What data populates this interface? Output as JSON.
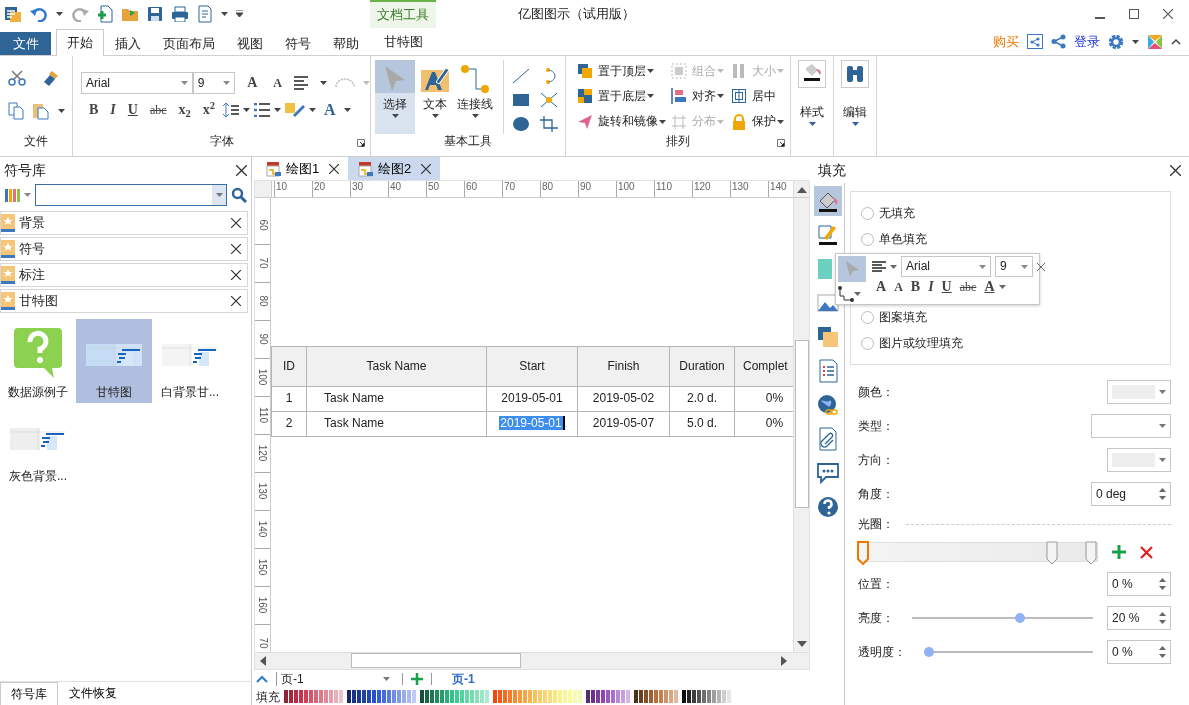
{
  "window": {
    "title": "亿图图示（试用版）",
    "tool_group": "文档工具"
  },
  "menu_tabs": [
    {
      "label": "文件",
      "kind": "file",
      "selected": false
    },
    {
      "label": "开始",
      "kind": "tab",
      "selected": true
    },
    {
      "label": "插入",
      "kind": "tab",
      "selected": false
    },
    {
      "label": "页面布局",
      "kind": "tab",
      "selected": false
    },
    {
      "label": "视图",
      "kind": "tab",
      "selected": false
    },
    {
      "label": "符号",
      "kind": "tab",
      "selected": false
    },
    {
      "label": "帮助",
      "kind": "tab",
      "selected": false
    },
    {
      "label": "甘特图",
      "kind": "context",
      "selected": false
    }
  ],
  "account": {
    "buy": "购买",
    "login": "登录"
  },
  "ribbon": {
    "file_group": {
      "label": "文件"
    },
    "font_group": {
      "label": "字体",
      "family": "Arial",
      "size": "9",
      "grow": "A",
      "shrink": "A",
      "color_glyph": "A",
      "styles": [
        {
          "text": "B",
          "kind": "bold"
        },
        {
          "text": "I",
          "kind": "italic"
        },
        {
          "text": "U",
          "kind": "underline"
        },
        {
          "text": "abc",
          "kind": "strike"
        },
        {
          "text": "x$_{2}$",
          "kind": "sub"
        },
        {
          "text": "x$^{2}$",
          "kind": "sup"
        }
      ]
    },
    "tools_group": {
      "label": "基本工具",
      "tools": [
        {
          "label": "选择",
          "kind": "select",
          "selected": true
        },
        {
          "label": "文本",
          "kind": "text",
          "selected": false
        },
        {
          "label": "连接线",
          "kind": "connector",
          "selected": false
        }
      ]
    },
    "arrange_group": {
      "label": "排列",
      "items": [
        {
          "label": "置于顶层",
          "kind": "front",
          "disabled": false,
          "dropdown": true
        },
        {
          "label": "组合",
          "kind": "group",
          "disabled": true,
          "dropdown": true
        },
        {
          "label": "大小",
          "kind": "size",
          "disabled": true,
          "dropdown": true
        },
        {
          "label": "置于底层",
          "kind": "back",
          "disabled": false,
          "dropdown": true
        },
        {
          "label": "对齐",
          "kind": "align",
          "disabled": false,
          "dropdown": true
        },
        {
          "label": "居中",
          "kind": "center",
          "disabled": false,
          "dropdown": false
        },
        {
          "label": "旋转和镜像",
          "kind": "rotate",
          "disabled": false,
          "dropdown": true
        },
        {
          "label": "分布",
          "kind": "distribute",
          "disabled": true,
          "dropdown": true
        },
        {
          "label": "保护",
          "kind": "protect",
          "disabled": false,
          "dropdown": true
        }
      ]
    },
    "style_group": {
      "label": "样式"
    },
    "edit_group": {
      "label": "编辑"
    }
  },
  "symbol_library": {
    "title": "符号库",
    "libraries": [
      {
        "label": "背景"
      },
      {
        "label": "符号"
      },
      {
        "label": "标注"
      },
      {
        "label": "甘特图"
      }
    ],
    "templates": [
      {
        "label": "数据源例子",
        "kind": "question",
        "selected": false
      },
      {
        "label": "甘特图",
        "kind": "gantt",
        "selected": true
      },
      {
        "label": "白背景甘...",
        "kind": "gantt-white",
        "selected": false
      },
      {
        "label": "灰色背景...",
        "kind": "gantt-gray",
        "selected": false
      }
    ],
    "bottom_tabs": [
      {
        "label": "符号库",
        "selected": true
      },
      {
        "label": "文件恢复",
        "selected": false
      }
    ]
  },
  "documents": [
    {
      "label": "绘图1",
      "selected": false
    },
    {
      "label": "绘图2",
      "selected": true
    }
  ],
  "rulers": {
    "horizontal": [
      "10",
      "20",
      "30",
      "40",
      "50",
      "60",
      "70",
      "80",
      "90",
      "100",
      "110",
      "120",
      "130",
      "140"
    ],
    "vertical": [
      "60",
      "70",
      "80",
      "90",
      "100",
      "110",
      "120",
      "130",
      "140",
      "150",
      "160",
      "70"
    ]
  },
  "table": {
    "columns": [
      "ID",
      "Task Name",
      "Start",
      "Finish",
      "Duration",
      "Complet"
    ],
    "rows": [
      {
        "cells": [
          {
            "text": "1",
            "selected": false
          },
          {
            "text": "Task Name",
            "selected": false
          },
          {
            "text": "2019-05-01",
            "selected": false
          },
          {
            "text": "2019-05-02",
            "selected": false
          },
          {
            "text": "2.0 d.",
            "selected": false
          },
          {
            "text": "0%",
            "selected": false
          }
        ]
      },
      {
        "cells": [
          {
            "text": "2",
            "selected": false
          },
          {
            "text": "Task Name",
            "selected": false
          },
          {
            "text": "2019-05-01",
            "selected": true
          },
          {
            "text": "2019-05-07",
            "selected": false
          },
          {
            "text": "5.0 d.",
            "selected": false
          },
          {
            "text": "0%",
            "selected": false
          }
        ]
      }
    ]
  },
  "pages": {
    "current": "页-1",
    "tabs": [
      {
        "label": "页-1",
        "selected": true
      }
    ]
  },
  "palette": {
    "label": "填充"
  },
  "fill_panel": {
    "title": "填充",
    "tools": [
      {
        "kind": "fill",
        "selected": true
      },
      {
        "kind": "line",
        "selected": false
      },
      {
        "kind": "shadow",
        "selected": false
      },
      {
        "kind": "image",
        "selected": false
      },
      {
        "kind": "layer",
        "selected": false
      },
      {
        "kind": "list",
        "selected": false
      },
      {
        "kind": "hyperlink",
        "selected": false
      },
      {
        "kind": "attachment",
        "selected": false
      },
      {
        "kind": "comment",
        "selected": false
      },
      {
        "kind": "help",
        "selected": false
      }
    ],
    "options": [
      {
        "label": "无填充",
        "selected": false
      },
      {
        "label": "单色填充",
        "selected": false
      },
      {
        "label": "图案填充",
        "selected": false
      },
      {
        "label": "图片或纹理填充",
        "selected": false
      }
    ],
    "color": {
      "label": "颜色：",
      "kind": "swatch"
    },
    "type": {
      "label": "类型：",
      "kind": "plain"
    },
    "direction": {
      "label": "方向：",
      "kind": "swatch"
    },
    "angle": {
      "label": "角度：",
      "value": "0 deg"
    },
    "gradient": {
      "label": "光圈：",
      "stops": [
        {
          "level": 0,
          "selected": true
        },
        {
          "level": 0.83,
          "selected": false
        },
        {
          "level": 1,
          "selected": false
        }
      ]
    },
    "position": {
      "label": "位置：",
      "value": "0 %"
    },
    "brightness": {
      "label": "亮度：",
      "level": 0.6,
      "value": "20 %"
    },
    "transparency": {
      "label": "透明度：",
      "level": 0,
      "value": "0 %"
    }
  },
  "mini_toolbar": {
    "family": "Arial",
    "size": "9",
    "grow": "A",
    "shrink": "A",
    "color_glyph": "A",
    "styles": [
      {
        "text": "B",
        "kind": "bold"
      },
      {
        "text": "I",
        "kind": "italic"
      },
      {
        "text": "U",
        "kind": "underline"
      },
      {
        "text": "abc",
        "kind": "strike"
      }
    ]
  }
}
